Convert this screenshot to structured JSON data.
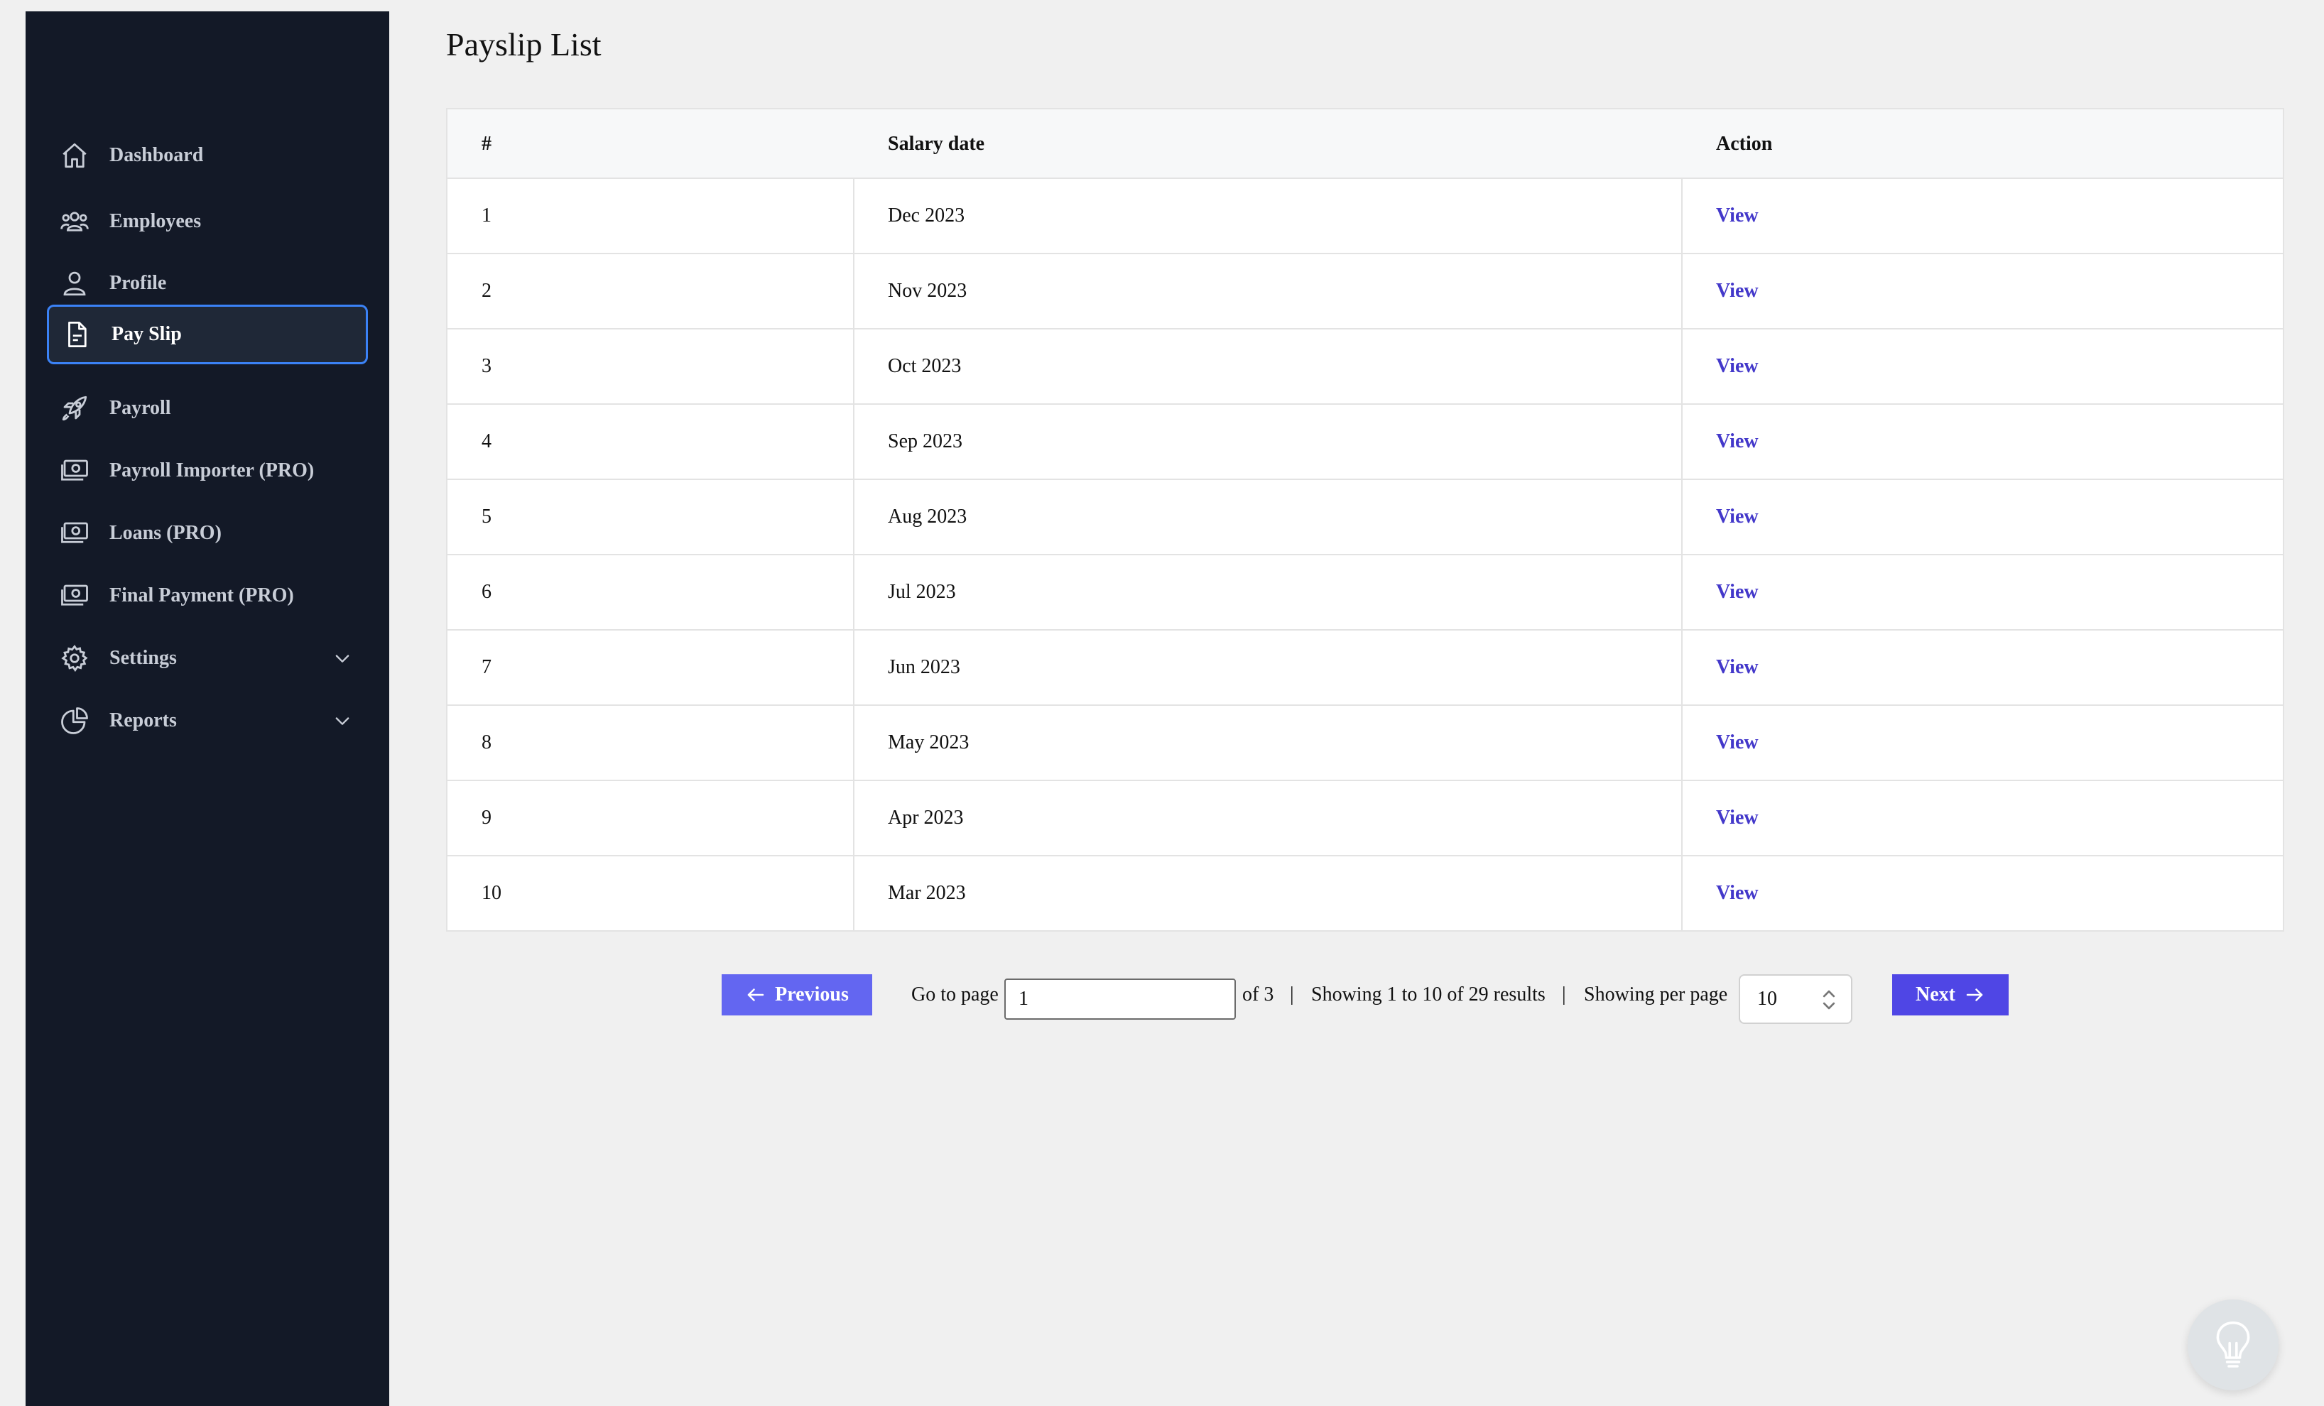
{
  "sidebar": {
    "items": [
      {
        "label": "Dashboard",
        "icon": "home-icon"
      },
      {
        "label": "Employees",
        "icon": "users-icon"
      },
      {
        "label": "Profile",
        "icon": "user-icon"
      },
      {
        "label": "Pay Slip",
        "icon": "document-icon",
        "active": true
      },
      {
        "label": "Payroll",
        "icon": "rocket-icon"
      },
      {
        "label": "Payroll Importer (PRO)",
        "icon": "cash-icon"
      },
      {
        "label": "Loans (PRO)",
        "icon": "cash-icon"
      },
      {
        "label": "Final Payment (PRO)",
        "icon": "cash-icon"
      },
      {
        "label": "Settings",
        "icon": "gear-icon",
        "expandable": true
      },
      {
        "label": "Reports",
        "icon": "pie-chart-icon",
        "expandable": true
      }
    ]
  },
  "page": {
    "title": "Payslip List"
  },
  "table": {
    "headers": [
      "#",
      "Salary date",
      "Action"
    ],
    "rows": [
      {
        "num": "1",
        "date": "Dec 2023",
        "action": "View"
      },
      {
        "num": "2",
        "date": "Nov 2023",
        "action": "View"
      },
      {
        "num": "3",
        "date": "Oct 2023",
        "action": "View"
      },
      {
        "num": "4",
        "date": "Sep 2023",
        "action": "View"
      },
      {
        "num": "5",
        "date": "Aug 2023",
        "action": "View"
      },
      {
        "num": "6",
        "date": "Jul 2023",
        "action": "View"
      },
      {
        "num": "7",
        "date": "Jun 2023",
        "action": "View"
      },
      {
        "num": "8",
        "date": "May 2023",
        "action": "View"
      },
      {
        "num": "9",
        "date": "Apr 2023",
        "action": "View"
      },
      {
        "num": "10",
        "date": "Mar 2023",
        "action": "View"
      }
    ]
  },
  "pagination": {
    "previous_label": "Previous",
    "go_to_page_label": "Go to page",
    "current_page": "1",
    "of_pages": "of 3",
    "separator": "|",
    "showing_text": "Showing 1 to 10 of 29 results",
    "per_page_label": "Showing per page",
    "per_page_value": "10",
    "next_label": "Next"
  },
  "colors": {
    "sidebar_bg": "#131927",
    "active_border": "#3b82f6",
    "accent": "#4f46e5",
    "link": "#4338ca"
  }
}
